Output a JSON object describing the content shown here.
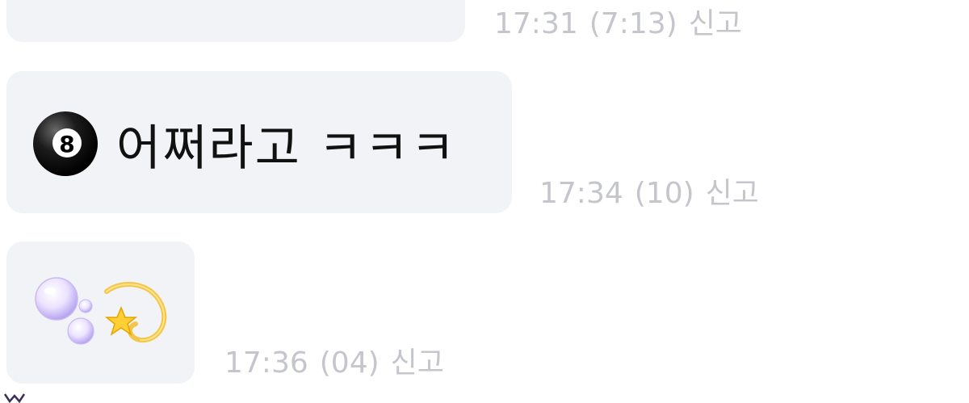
{
  "messages": [
    {
      "text": "",
      "time": "17:31",
      "elapsed": "(7:13)",
      "report_label": "신고"
    },
    {
      "emoji": "8-ball-icon",
      "text": "어쩌라고 ㅋㅋㅋ",
      "time": "17:34",
      "elapsed": "(10)",
      "report_label": "신고"
    },
    {
      "emoji_only": [
        "bubbles-icon",
        "dizzy-star-icon"
      ],
      "time": "17:36",
      "elapsed": "(04)",
      "report_label": "신고"
    }
  ],
  "colors": {
    "bubble_bg": "#f2f3f6",
    "meta_text": "#c4c6cc",
    "message_text": "#111111"
  }
}
